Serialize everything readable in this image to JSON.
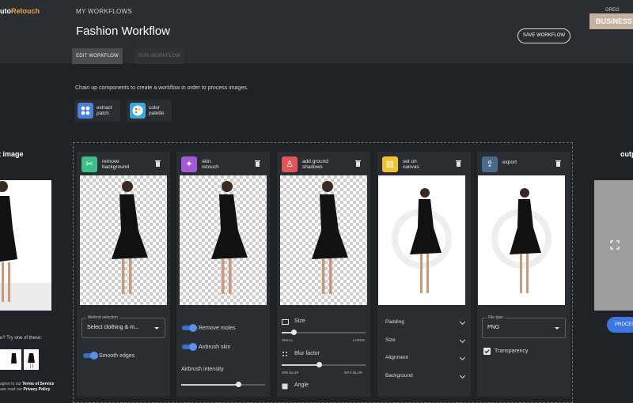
{
  "app": {
    "logo_prefix": "uto",
    "logo_suffix": "Retouch",
    "user": "GREG"
  },
  "header": {
    "breadcrumb": "MY WORKFLOWS",
    "title": "Fashion Workflow",
    "tabs": [
      {
        "label": "EDIT WORKFLOW",
        "active": true
      },
      {
        "label": "RUN WORKFLOW",
        "active": false
      }
    ],
    "save_label": "SAVE WORKFLOW",
    "badge": "BUSINESS"
  },
  "intro": "Chain up components to create a workflow in order to process images.",
  "components": [
    {
      "label_1": "extract",
      "label_2": "patch",
      "icon": "grid-dots-icon",
      "color": "#4a7de0"
    },
    {
      "label_1": "color",
      "label_2": "palette",
      "icon": "palette-icon",
      "color": "#3fa6e0"
    }
  ],
  "input_panel": {
    "title": "t image",
    "try_text": "e? Try one of these:",
    "terms_1": "agree to our",
    "terms_link_1": "Terms of Service",
    "terms_2": "ase read our",
    "terms_link_2": "Privacy Policy"
  },
  "steps": [
    {
      "label_1": "remove",
      "label_2": "background",
      "icon": "scissors-icon",
      "color": "#3dbf8a",
      "bg": "checker",
      "method_caption": "Method selection",
      "method_value": "Select clothing & m...",
      "toggle_label": "Smooth edges"
    },
    {
      "label_1": "skin",
      "label_2": "retouch",
      "icon": "wand-icon",
      "color": "#a25ad6",
      "bg": "checker",
      "toggles": [
        "Remove moles",
        "Airbrush skin"
      ],
      "slider_label": "Airbrush intensity",
      "slider_value": 0.68
    },
    {
      "label_1": "add ground",
      "label_2": "shadows",
      "icon": "lamp-icon",
      "color": "#e0565a",
      "bg": "checker",
      "size_label": "Size",
      "size_min": "SMALL",
      "size_max": "LARGE",
      "size_value": 0.15,
      "blur_label": "Blur factor",
      "blur_min": "MIN BLUR",
      "blur_max": "MAX BLUR",
      "blur_value": 0.45,
      "angle_label": "Angle"
    },
    {
      "label_1": "set on",
      "label_2": "canvas",
      "icon": "canvas-icon",
      "color": "#f2c230",
      "bg": "white",
      "options": [
        "Padding",
        "Size",
        "Alignment",
        "Background"
      ]
    },
    {
      "label_1": "export",
      "label_2": "",
      "icon": "export-icon",
      "color": "#4a6a8a",
      "bg": "white",
      "filetype_caption": "File type",
      "filetype_value": "PNG",
      "transparency_label": "Transparency",
      "transparency_checked": true
    }
  ],
  "output_panel": {
    "title": "outp",
    "process_label": "PROCES"
  }
}
